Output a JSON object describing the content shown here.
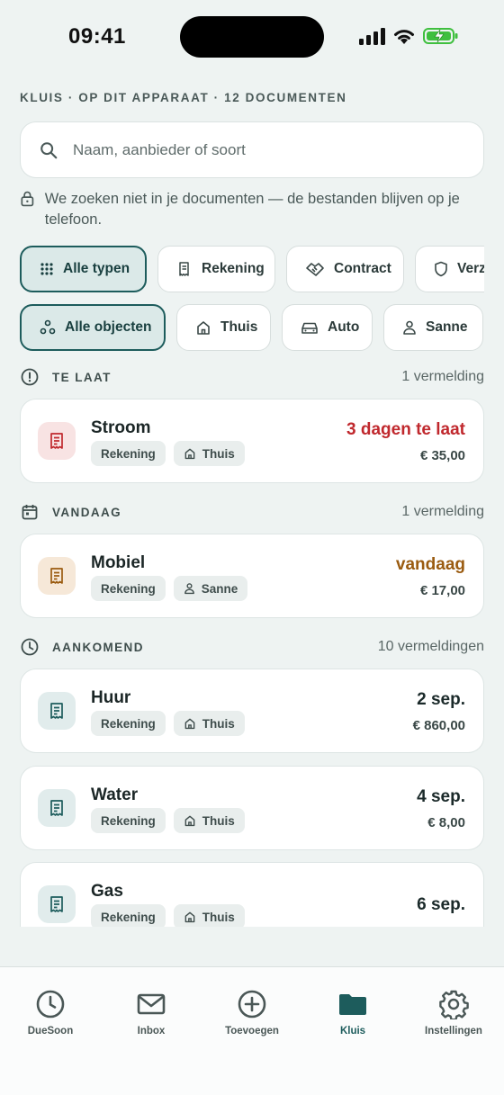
{
  "status_bar": {
    "time": "09:41"
  },
  "header": {
    "vault_label": "KLUIS · OP DIT APPARAAT · 12 DOCUMENTEN"
  },
  "search": {
    "placeholder": "Naam, aanbieder of soort",
    "value": ""
  },
  "privacy_note": "We zoeken niet in je documenten — de bestanden blijven op je telefoon.",
  "type_filters": [
    {
      "label": "Alle typen",
      "icon": "grid-icon",
      "active": true
    },
    {
      "label": "Rekening",
      "icon": "receipt-icon",
      "active": false
    },
    {
      "label": "Contract",
      "icon": "handshake-icon",
      "active": false
    },
    {
      "label": "Verzekering",
      "icon": "shield-icon",
      "active": false
    }
  ],
  "object_filters": [
    {
      "label": "Alle objecten",
      "icon": "objects-icon",
      "active": true
    },
    {
      "label": "Thuis",
      "icon": "house-icon",
      "active": false
    },
    {
      "label": "Auto",
      "icon": "car-icon",
      "active": false
    },
    {
      "label": "Sanne",
      "icon": "person-icon",
      "active": false
    }
  ],
  "sections": {
    "late": {
      "label": "TE LAAT",
      "count": "1 vermelding",
      "icon": "alert-circle-icon"
    },
    "today": {
      "label": "VANDAAG",
      "count": "1 vermelding",
      "icon": "calendar-icon"
    },
    "upcoming": {
      "label": "AANKOMEND",
      "count": "10 vermeldingen",
      "icon": "clock-icon"
    }
  },
  "items": [
    {
      "title": "Stroom",
      "type": "Rekening",
      "object": "Thuis",
      "object_icon": "house-icon",
      "due": "3 dagen te laat",
      "amount": "€ 35,00",
      "due_color": "#c0282d",
      "icon_bg": "#f8e3e3",
      "icon_color": "#c0282d"
    },
    {
      "title": "Mobiel",
      "type": "Rekening",
      "object": "Sanne",
      "object_icon": "person-icon",
      "due": "vandaag",
      "amount": "€ 17,00",
      "due_color": "#9a5b10",
      "icon_bg": "#f6e8d8",
      "icon_color": "#9a5b10"
    },
    {
      "title": "Huur",
      "type": "Rekening",
      "object": "Thuis",
      "object_icon": "house-icon",
      "due": "2 sep.",
      "amount": "€ 860,00",
      "due_color": "#1b2626",
      "icon_bg": "#e1ecec",
      "icon_color": "#1d5c5c"
    },
    {
      "title": "Water",
      "type": "Rekening",
      "object": "Thuis",
      "object_icon": "house-icon",
      "due": "4 sep.",
      "amount": "€ 8,00",
      "due_color": "#1b2626",
      "icon_bg": "#e1ecec",
      "icon_color": "#1d5c5c"
    },
    {
      "title": "Gas",
      "type": "Rekening",
      "object": "Thuis",
      "object_icon": "house-icon",
      "due": "6 sep.",
      "amount": "",
      "due_color": "#1b2626",
      "icon_bg": "#e1ecec",
      "icon_color": "#1d5c5c"
    }
  ],
  "tabbar": [
    {
      "label": "DueSoon",
      "icon": "clock-icon",
      "active": false
    },
    {
      "label": "Inbox",
      "icon": "mail-icon",
      "active": false
    },
    {
      "label": "Toevoegen",
      "icon": "plus-circle-icon",
      "active": false
    },
    {
      "label": "Kluis",
      "icon": "folder-icon",
      "active": true
    },
    {
      "label": "Instellingen",
      "icon": "gear-icon",
      "active": false
    }
  ],
  "colors": {
    "accent": "#1d5c5c",
    "background": "#eef3f2",
    "late": "#c0282d",
    "today": "#9a5b10"
  }
}
